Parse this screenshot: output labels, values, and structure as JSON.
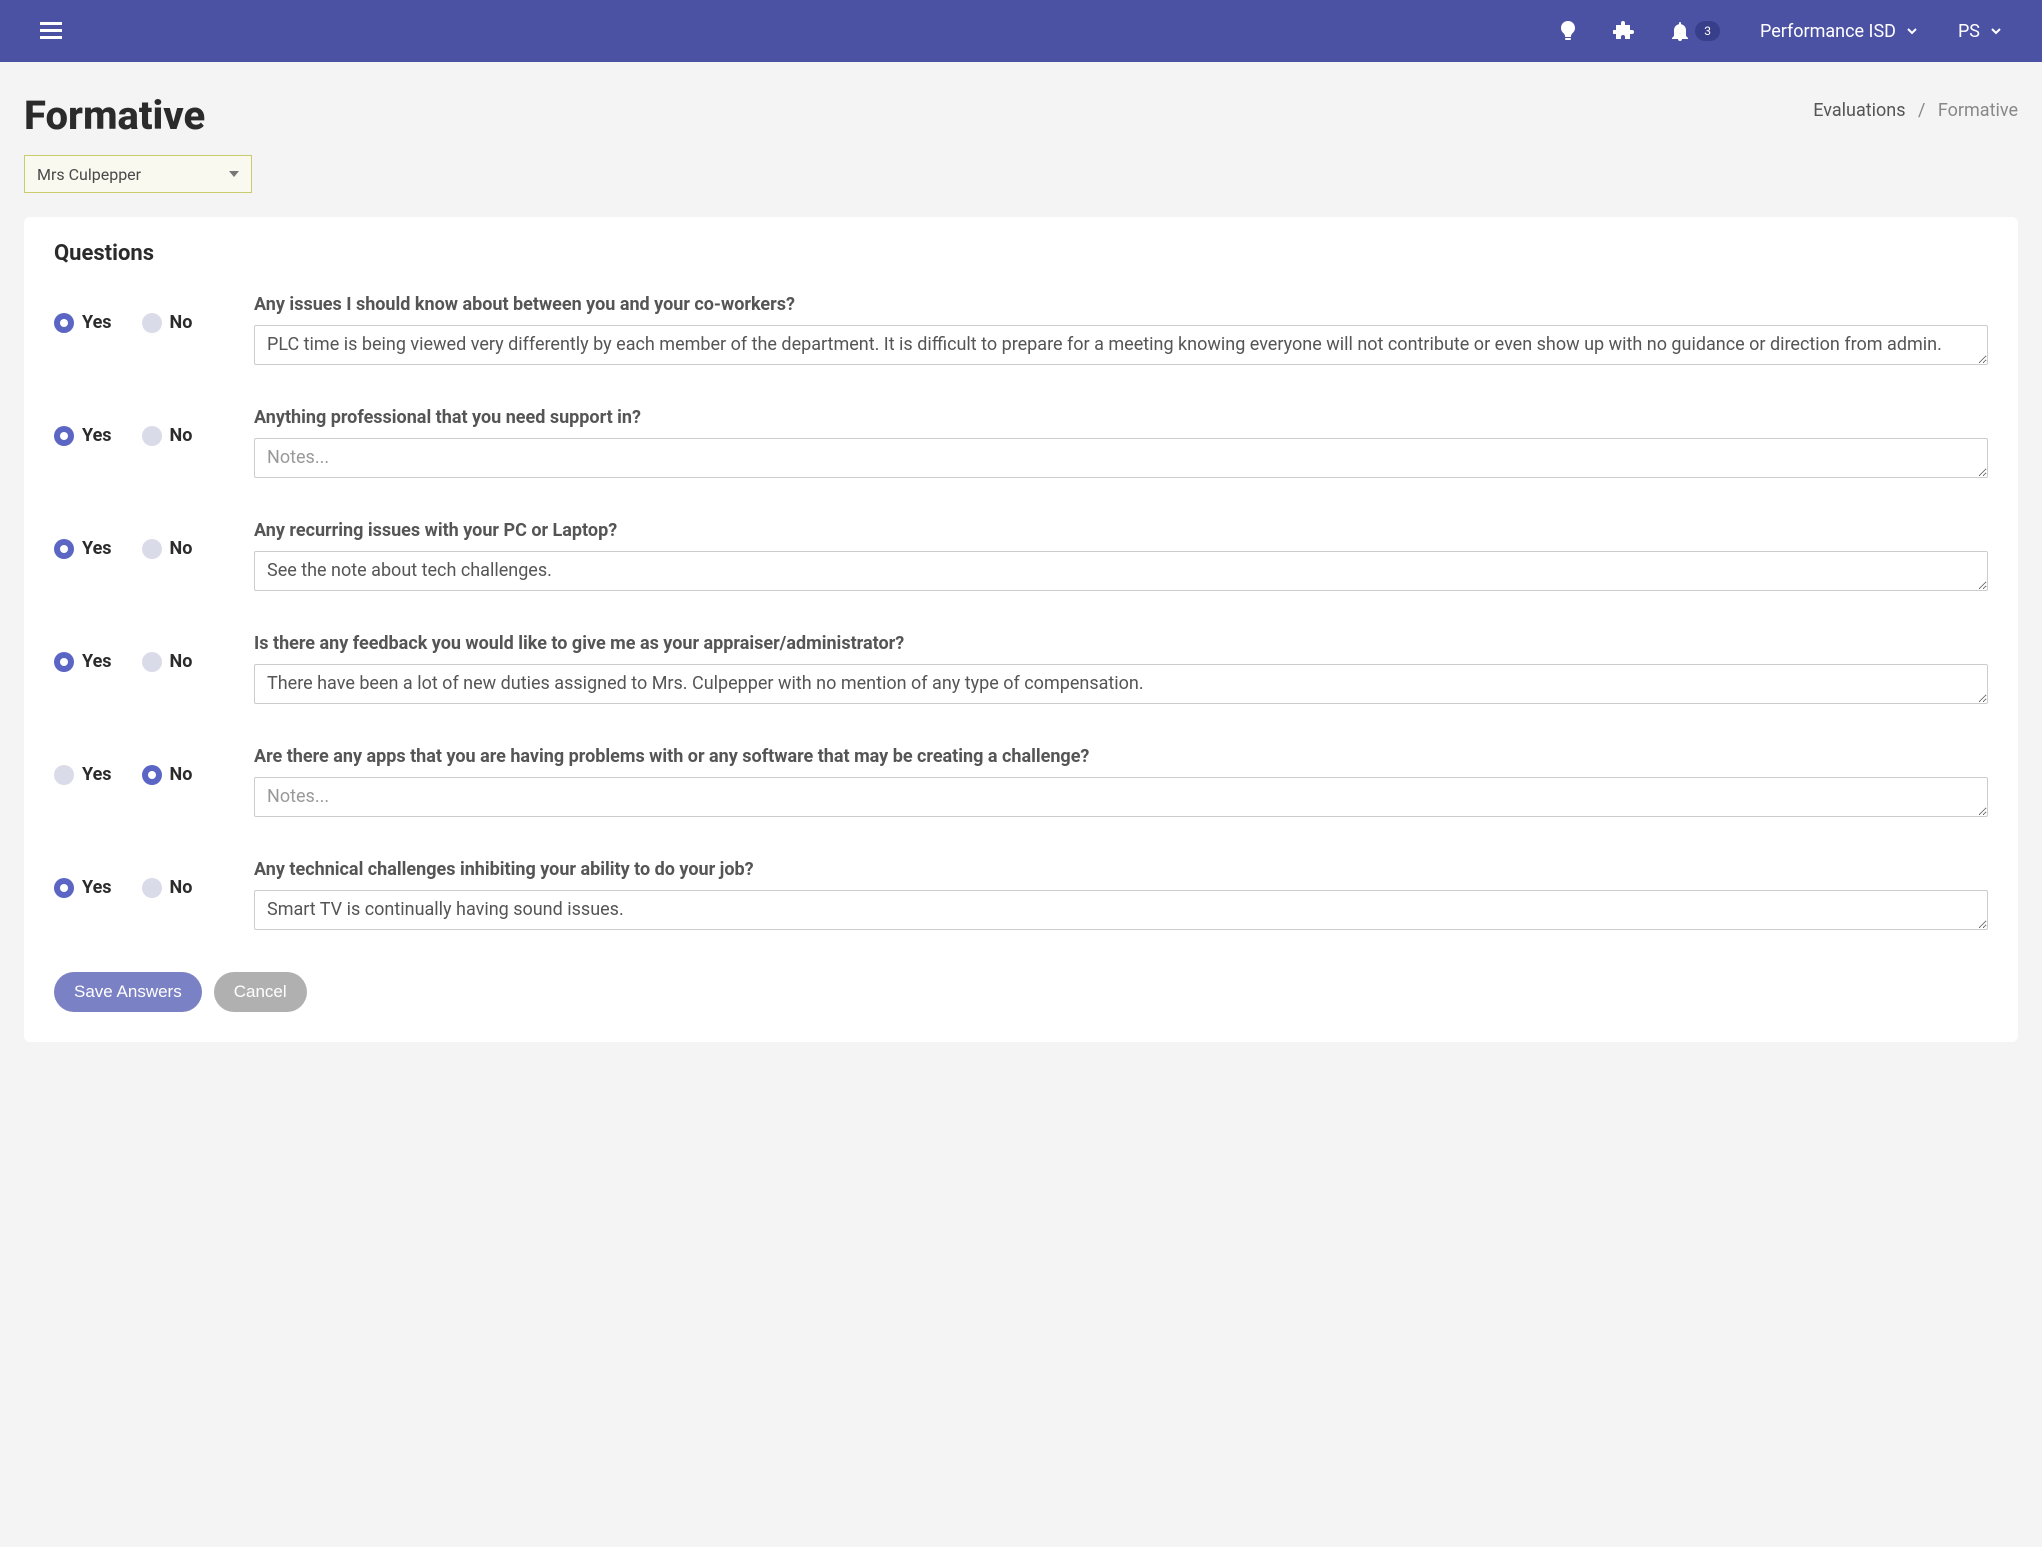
{
  "header": {
    "org_label": "Performance ISD",
    "user_label": "PS",
    "notification_count": "3"
  },
  "page": {
    "title": "Formative",
    "select_value": "Mrs Culpepper"
  },
  "breadcrumb": {
    "parent": "Evaluations",
    "current": "Formative"
  },
  "card": {
    "title": "Questions"
  },
  "labels": {
    "yes": "Yes",
    "no": "No",
    "notes_placeholder": "Notes..."
  },
  "questions": [
    {
      "prompt": "Any issues I should know about between you and your co-workers?",
      "answer": "yes",
      "text": "PLC time is being viewed very differently by each member of the department. It is difficult to prepare for a meeting knowing everyone will not contribute or even show up with no guidance or direction from admin."
    },
    {
      "prompt": "Anything professional that you need support in?",
      "answer": "yes",
      "text": ""
    },
    {
      "prompt": "Any recurring issues with your PC or Laptop?",
      "answer": "yes",
      "text": "See the note about tech challenges."
    },
    {
      "prompt": "Is there any feedback you would like to give me as your appraiser/administrator?",
      "answer": "yes",
      "text": "There have been a lot of new duties assigned to Mrs. Culpepper with no mention of any type of compensation."
    },
    {
      "prompt": "Are there any apps that you are having problems with or any software that may be creating a challenge?",
      "answer": "no",
      "text": ""
    },
    {
      "prompt": "Any technical challenges inhibiting your ability to do your job?",
      "answer": "yes",
      "text": "Smart TV is continually having sound issues."
    }
  ],
  "buttons": {
    "save": "Save Answers",
    "cancel": "Cancel"
  }
}
